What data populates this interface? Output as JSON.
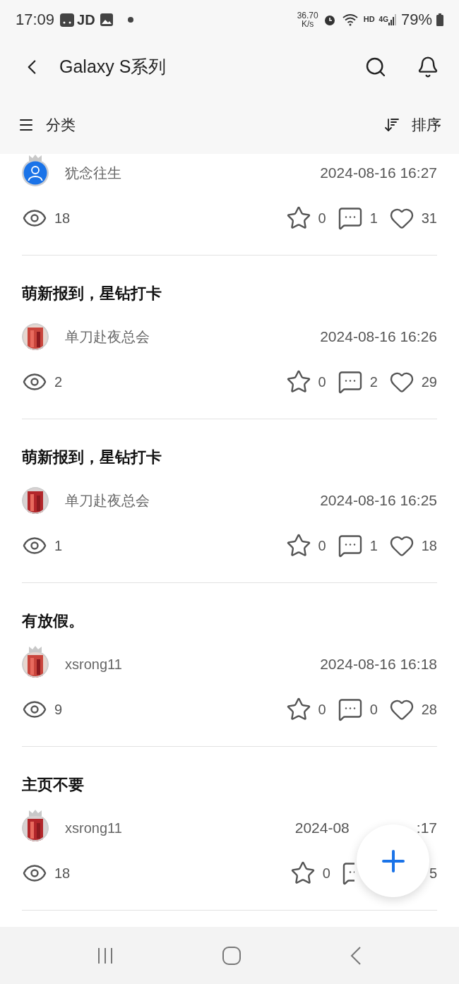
{
  "status_bar": {
    "time": "17:09",
    "app_label": "JD",
    "speed": "36.70",
    "speed_unit": "K/s",
    "network": "HD",
    "network_type": "4G",
    "battery": "79%"
  },
  "header": {
    "title": "Galaxy S系列"
  },
  "toolbar": {
    "filter": "分类",
    "sort": "排序"
  },
  "posts": [
    {
      "user": "犹念往生",
      "avatar": {
        "kind": "default"
      },
      "crown": true,
      "date": "2024-08-16 16:27",
      "views": "18",
      "stars": "0",
      "comments": "1",
      "likes": "31"
    },
    {
      "title": "萌新报到，星钻打卡",
      "user": "单刀赴夜总会",
      "crown": false,
      "date": "2024-08-16 16:26",
      "views": "2",
      "stars": "0",
      "comments": "2",
      "likes": "29"
    },
    {
      "title": "萌新报到，星钻打卡",
      "user": "单刀赴夜总会",
      "crown": false,
      "date": "2024-08-16 16:25",
      "views": "1",
      "stars": "0",
      "comments": "1",
      "likes": "18"
    },
    {
      "title": "有放假。",
      "user": "xsrong11",
      "crown": true,
      "date": "2024-08-16 16:18",
      "views": "9",
      "stars": "0",
      "comments": "0",
      "likes": "28"
    },
    {
      "title": "主页不要",
      "user": "xsrong11",
      "crown": true,
      "date": "2024-08",
      "date_tail": ":17",
      "views": "18",
      "stars": "0",
      "likes": "5"
    }
  ]
}
